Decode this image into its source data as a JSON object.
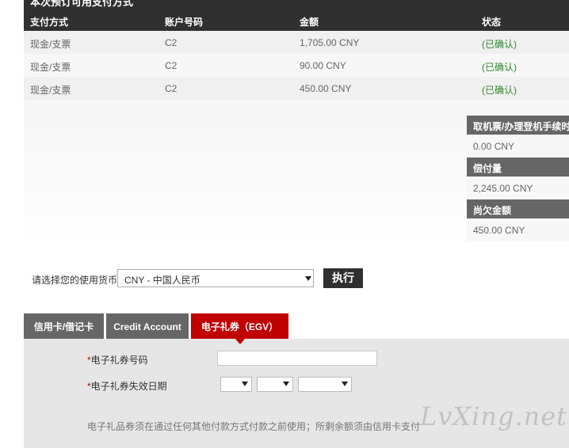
{
  "payment_table": {
    "title": "本次预订可用支付方式",
    "columns": [
      "支付方式",
      "账户号码",
      "金额",
      "状态"
    ],
    "rows": [
      {
        "method": "现金/支票",
        "account": "C2",
        "amount": "1,705.00 CNY",
        "status": "(已确认)"
      },
      {
        "method": "现金/支票",
        "account": "C2",
        "amount": "90.00 CNY",
        "status": "(已确认)"
      },
      {
        "method": "现金/支票",
        "account": "C2",
        "amount": "450.00 CNY",
        "status": "(已确认)"
      }
    ]
  },
  "summary": {
    "fee_label": "取机票/办理登机手续时",
    "fee_value": "0.00 CNY",
    "paid_label": "偿付量",
    "paid_value": "2,245.00 CNY",
    "due_label": "尚欠金额",
    "due_value": "450.00 CNY"
  },
  "currency": {
    "label": "请选择您的使用货币",
    "selected": "CNY - 中国人民币",
    "execute_label": "执行"
  },
  "tabs": [
    {
      "label": "信用卡/借记卡",
      "active": false
    },
    {
      "label": "Credit Account",
      "active": false
    },
    {
      "label": "电子礼券（EGV）",
      "active": true
    }
  ],
  "egv_form": {
    "required_mark": "*",
    "number_label": "电子礼券号码",
    "number_value": "",
    "expiry_label": "电子礼券失效日期",
    "note": "电子礼品券须在通过任何其他付款方式付款之前使用；所剩余额须由信用卡支付"
  },
  "watermark": "LvXing.net",
  "colors": {
    "header": "#303030",
    "active_tab": "#c00000",
    "inactive_tab": "#666666",
    "status_confirmed": "#2e8b2e",
    "panel": "#e6e6e6"
  }
}
